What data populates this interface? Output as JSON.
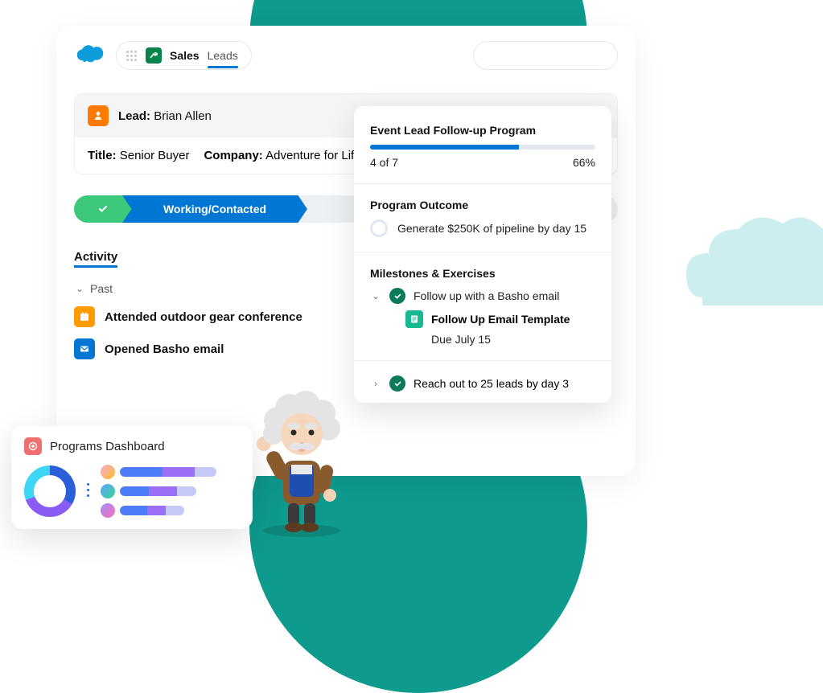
{
  "topbar": {
    "tab_main": "Sales",
    "tab_sub": "Leads"
  },
  "lead": {
    "prefix": "Lead:",
    "name": "Brian Allen",
    "title_label": "Title:",
    "title_value": "Senior Buyer",
    "company_label": "Company:",
    "company_value": "Adventure for Life"
  },
  "status": {
    "label": "Working/Contacted"
  },
  "activity": {
    "heading": "Activity",
    "past_label": "Past",
    "items": [
      "Attended outdoor gear conference",
      "Opened Basho email"
    ]
  },
  "program": {
    "title": "Event Lead Follow-up Program",
    "progress_text": "4 of 7",
    "percent_text": "66%",
    "percent_value": 66,
    "outcome_heading": "Program Outcome",
    "outcome_text": "Generate $250K of pipeline by day 15",
    "milestones_heading": "Milestones & Exercises",
    "milestone1": "Follow up with a Basho email",
    "template_label": "Follow Up Email Template",
    "due_text": "Due July 15",
    "milestone2": "Reach out to 25 leads by day 3"
  },
  "dashboard": {
    "title": "Programs Dashboard"
  }
}
